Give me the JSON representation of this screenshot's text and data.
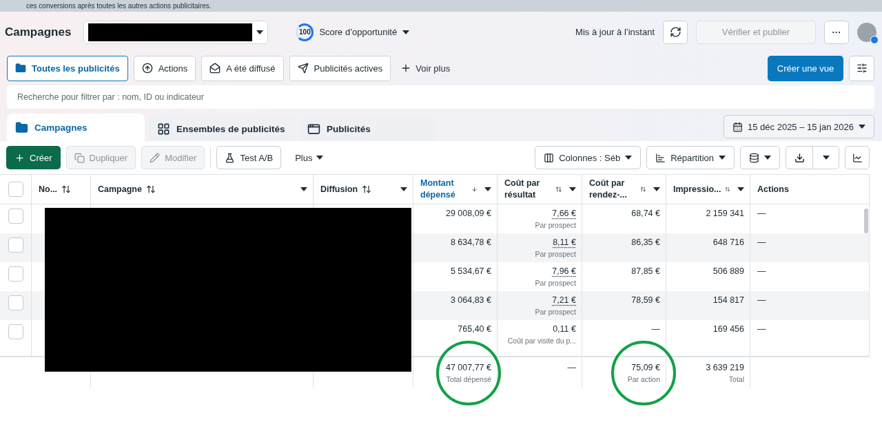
{
  "banner": {
    "text": "ces conversions après toutes les autres actions publicitaires."
  },
  "header": {
    "title": "Campagnes",
    "score": {
      "value": "100",
      "label": "Score d’opportunité"
    },
    "status": "Mis à jour à l’instant",
    "publish": {
      "label": "Vérifier et publier",
      "disabled": true
    },
    "more": "···"
  },
  "filters": [
    {
      "label": "Toutes les publicités",
      "selected": true
    },
    {
      "label": "Actions",
      "selected": false
    },
    {
      "label": "A été diffusé",
      "selected": false
    },
    {
      "label": "Publicités actives",
      "selected": false
    }
  ],
  "see_more": "Voir plus",
  "create_view": "Créer une vue",
  "search": {
    "placeholder": "Recherche pour filtrer par : nom, ID ou indicateur"
  },
  "level_tabs": [
    {
      "label": "Campagnes",
      "selected": true
    },
    {
      "label": "Ensembles de publicités",
      "selected": false
    },
    {
      "label": "Publicités",
      "selected": false
    }
  ],
  "date_range": "15 déc 2025 – 15 jan 2026",
  "toolbar": [
    {
      "label": "Créer",
      "kind": "primary",
      "disabled": false
    },
    {
      "label": "Dupliquer",
      "kind": "copy",
      "disabled": true
    },
    {
      "label": "Modifier",
      "kind": "edit",
      "disabled": true
    },
    {
      "label": "Test A/B",
      "kind": "test",
      "disabled": false
    },
    {
      "label": "Plus",
      "kind": "menu",
      "disabled": false
    }
  ],
  "columns_button": "Colonnes : Séb",
  "breakdown_button": "Répartition",
  "table": {
    "all_checked": false,
    "columns": [
      {
        "label": "No...",
        "kind": "sortable",
        "active": false
      },
      {
        "label": "Campagne",
        "kind": "sortable",
        "active": false
      },
      {
        "label": "Diffusion",
        "kind": "sortable",
        "active": false
      },
      {
        "label": "Montant dépensé",
        "kind": "sortable",
        "active": true
      },
      {
        "label": "Coût par résultat",
        "kind": "sortable",
        "active": false
      },
      {
        "label": "Coût par rendez-...",
        "kind": "sortable",
        "active": false
      },
      {
        "label": "Impressio...",
        "kind": "sortable",
        "active": false
      },
      {
        "label": "Actions",
        "kind": "plain",
        "active": false
      }
    ],
    "rows": [
      {
        "checked": false,
        "spent": "29 008,09 €",
        "cost": "7,66 €",
        "cost_underlined": true,
        "cost_note": "Par prospect",
        "cost_rdv": "68,74 €",
        "impressions": "2 159 341",
        "actions": "—"
      },
      {
        "checked": false,
        "spent": "8 634,78 €",
        "cost": "8,11 €",
        "cost_underlined": true,
        "cost_note": "Par prospect",
        "cost_rdv": "86,35 €",
        "impressions": "648 716",
        "actions": "—"
      },
      {
        "checked": false,
        "spent": "5 534,67 €",
        "cost": "7,96 €",
        "cost_underlined": true,
        "cost_note": "Par prospect",
        "cost_rdv": "87,85 €",
        "impressions": "506 889",
        "actions": "—"
      },
      {
        "checked": false,
        "spent": "3 064,83 €",
        "cost": "7,21 €",
        "cost_underlined": true,
        "cost_note": "Par prospect",
        "cost_rdv": "78,59 €",
        "impressions": "154 817",
        "actions": "—"
      },
      {
        "checked": false,
        "spent": "765,40 €",
        "cost": "0,11 €",
        "cost_underlined": false,
        "cost_note": "Coût par visite du p...",
        "cost_rdv": "—",
        "impressions": "169 456",
        "actions": "—"
      }
    ],
    "totals": [
      {
        "value": "47 007,77 €",
        "note": "Total dépensé",
        "circled": true
      },
      {
        "value": "—",
        "circled": false
      },
      {
        "value": "75,09 €",
        "note": "Par action",
        "circled": true
      },
      {
        "value": "3 639 219",
        "note": "Total",
        "circled": false
      }
    ]
  }
}
